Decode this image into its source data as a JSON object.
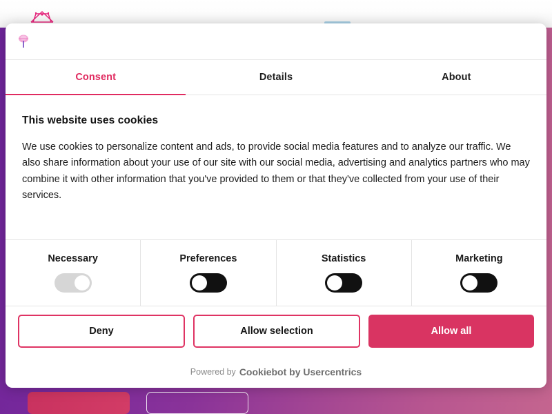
{
  "background_page": {
    "logo_icon": "site-logo-icon",
    "nav_active_underline": "nav-active-indicator",
    "cta_primary_label": "",
    "cta_secondary_label": "",
    "gradient_from": "#6d2499",
    "gradient_to": "#c4658f"
  },
  "dialog": {
    "logo_icon": "cookiebot-logo-icon",
    "accent_color": "#d93462",
    "tabs": [
      {
        "label": "Consent",
        "active": true
      },
      {
        "label": "Details",
        "active": false
      },
      {
        "label": "About",
        "active": false
      }
    ],
    "body": {
      "title": "This website uses cookies",
      "text": "We use cookies to personalize content and ads, to provide social media features and to analyze our traffic. We also share information about your use of our site with our social media, advertising and analytics partners who may combine it with other information that you've provided to them or that they've collected from your use of their services."
    },
    "categories": [
      {
        "label": "Necessary",
        "state": "on-disabled"
      },
      {
        "label": "Preferences",
        "state": "off"
      },
      {
        "label": "Statistics",
        "state": "off"
      },
      {
        "label": "Marketing",
        "state": "off"
      }
    ],
    "actions": {
      "deny": "Deny",
      "allow_selection": "Allow selection",
      "allow_all": "Allow all"
    },
    "footer": {
      "powered_by": "Powered by",
      "brand": "Cookiebot by Usercentrics"
    }
  }
}
